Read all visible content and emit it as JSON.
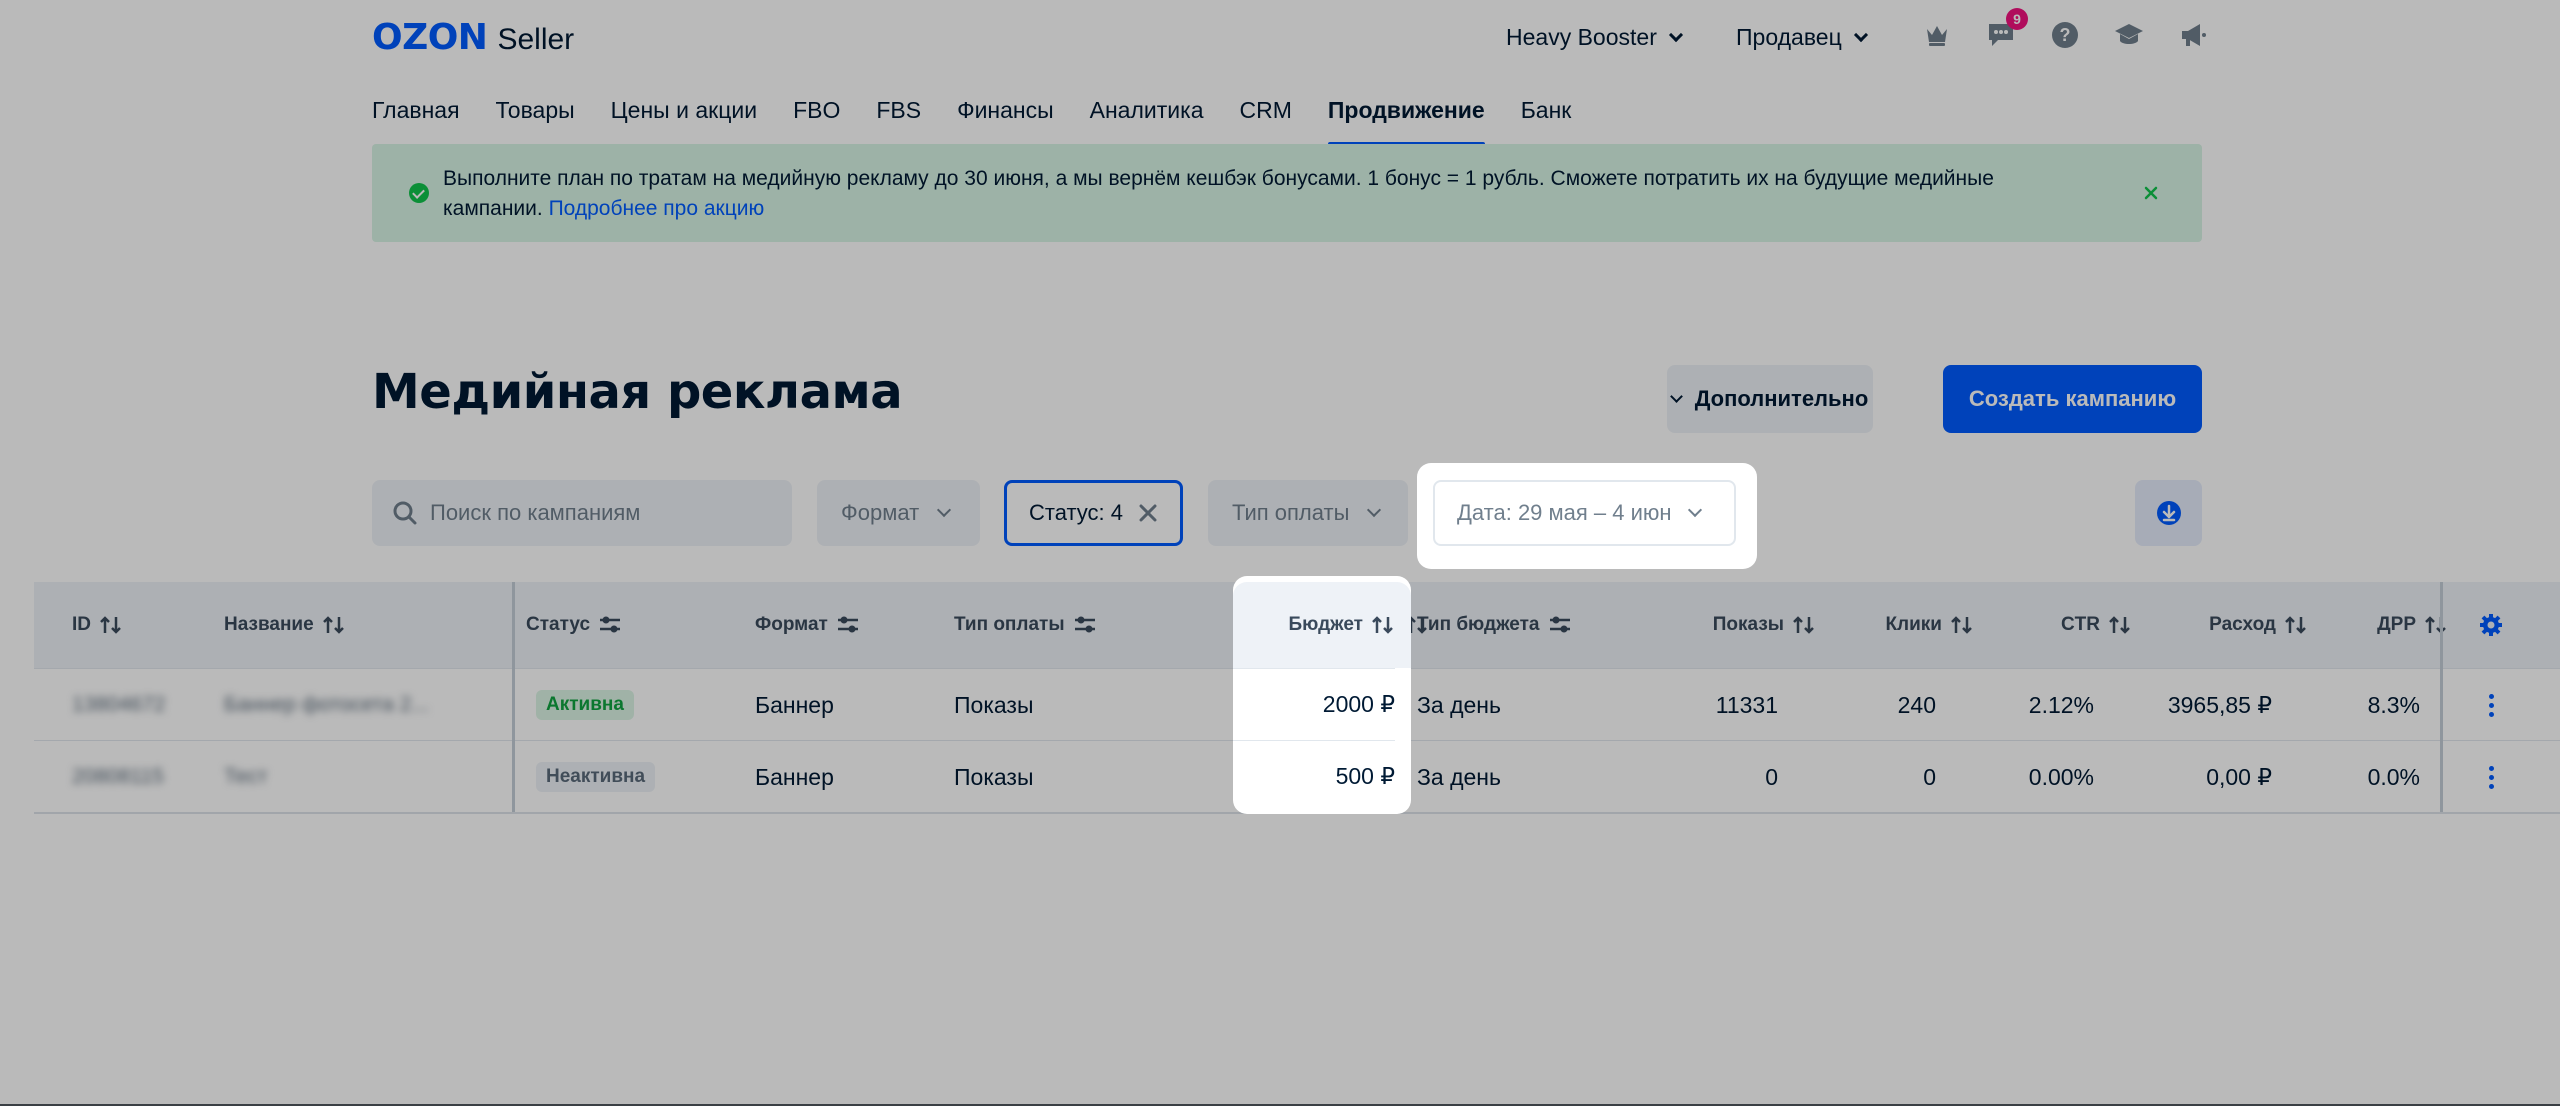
{
  "header": {
    "logo_brand": "OZON",
    "logo_product": "Seller",
    "company": "Heavy Booster",
    "role": "Продавец",
    "notification_count": "9",
    "icons": [
      "crown-icon",
      "chat-icon",
      "help-icon",
      "education-icon",
      "megaphone-icon"
    ]
  },
  "nav": {
    "items": [
      "Главная",
      "Товары",
      "Цены и акции",
      "FBO",
      "FBS",
      "Финансы",
      "Аналитика",
      "CRM",
      "Продвижение",
      "Банк"
    ],
    "active": "Продвижение"
  },
  "banner": {
    "text": "Выполните план по тратам на медийную рекламу до 30 июня, а мы вернём кешбэк бонусами. 1 бонус = 1 рубль. Сможете потратить их на будущие медийные кампании.",
    "link": "Подробнее про акцию"
  },
  "page": {
    "title": "Медийная реклама",
    "more_button": "Дополнительно",
    "create_button": "Создать кампанию"
  },
  "filters": {
    "search_placeholder": "Поиск по кампаниям",
    "format": "Формат",
    "status": "Статус: 4",
    "payment_type": "Тип оплаты",
    "date": "Дата: 29 мая – 4 июн"
  },
  "table": {
    "columns": [
      "ID",
      "Название",
      "Статус",
      "Формат",
      "Тип оплаты",
      "Бюджет",
      "Тип бюджета",
      "Показы",
      "Клики",
      "CTR",
      "Расход",
      "ДРР"
    ],
    "rows": [
      {
        "id": "13804672",
        "name": "Баннер фотосета 2...",
        "status": "Активна",
        "format": "Баннер",
        "payment": "Показы",
        "budget": "2000 ₽",
        "budget_type": "За день",
        "shows": "11331",
        "clicks": "240",
        "ctr": "2.12%",
        "spend": "3965,85 ₽",
        "drr": "8.3%"
      },
      {
        "id": "20808115",
        "name": "Тест",
        "status": "Неактивна",
        "format": "Баннер",
        "payment": "Показы",
        "budget": "500 ₽",
        "budget_type": "За день",
        "shows": "0",
        "clicks": "0",
        "ctr": "0.00%",
        "spend": "0,00 ₽",
        "drr": "0.0%"
      }
    ]
  },
  "colors": {
    "brand_blue": "#005bff",
    "banner_bg": "#d8f5e5",
    "active_green": "#10a441",
    "badge_pink": "#f1117e"
  }
}
